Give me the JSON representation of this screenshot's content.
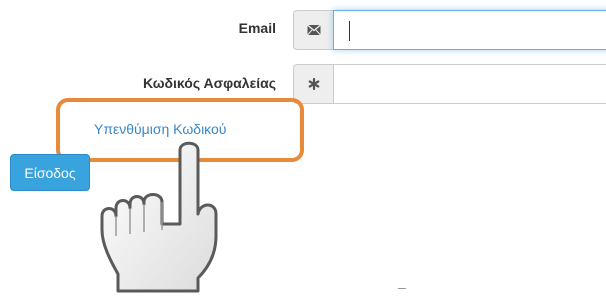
{
  "form": {
    "email_label": "Email",
    "email_value": "",
    "email_icon": "envelope-icon",
    "password_label": "Κωδικός Ασφαλείας",
    "password_value": "",
    "password_icon": "asterisk-icon",
    "forgot_password_link": "Υπενθύμιση Κωδικού",
    "submit_button": "Είσοδος"
  },
  "overlay": {
    "highlight_color": "#e98a3a",
    "pointer_icon": "hand-pointer-icon"
  },
  "colors": {
    "link": "#3a87c8",
    "button": "#38a3dd",
    "focus_border": "#66afe9"
  }
}
